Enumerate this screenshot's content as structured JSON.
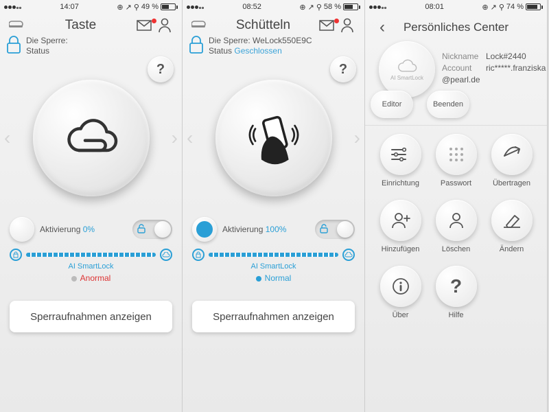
{
  "panels": [
    {
      "status": {
        "time": "14:07",
        "battery_pct": "49 %",
        "battery_fill": 0.49
      },
      "title": "Taste",
      "lock": {
        "name_key": "Die Sperre:",
        "name_val": "",
        "status_key": "Status",
        "status_val": ""
      },
      "dial_icon": "cloud",
      "activation": {
        "label": "Aktivierung",
        "pct": "0%",
        "on": false
      },
      "bar_label": "AI SmartLock",
      "state": {
        "text": "Anormal",
        "class": "bad"
      },
      "button": "Sperraufnahmen anzeigen"
    },
    {
      "status": {
        "time": "08:52",
        "battery_pct": "58 %",
        "battery_fill": 0.58
      },
      "title": "Schütteln",
      "lock": {
        "name_key": "Die Sperre:",
        "name_val": "WeLock550E9C",
        "status_key": "Status",
        "status_val": "Geschlossen"
      },
      "dial_icon": "shake",
      "activation": {
        "label": "Aktivierung",
        "pct": "100%",
        "on": true
      },
      "bar_label": "AI SmartLock",
      "state": {
        "text": "Normal",
        "class": "ok"
      },
      "button": "Sperraufnahmen anzeigen"
    }
  ],
  "panel3": {
    "status": {
      "time": "08:01",
      "battery_pct": "74 %",
      "battery_fill": 0.74
    },
    "title": "Persönliches Center",
    "avatar_caption": "AI SmartLock",
    "profile": {
      "nickname_key": "Nickname",
      "nickname_val": "Lock#2440",
      "account_key": "Account",
      "account_val": "ric*****.franziska@pearl.de"
    },
    "editor": "Editor",
    "beenden": "Beenden",
    "grid": [
      {
        "icon": "settings",
        "label": "Einrichtung"
      },
      {
        "icon": "password",
        "label": "Passwort"
      },
      {
        "icon": "share",
        "label": "Übertragen"
      },
      {
        "icon": "user-plus",
        "label": "Hinzufügen"
      },
      {
        "icon": "user",
        "label": "Löschen"
      },
      {
        "icon": "eraser",
        "label": "Ändern"
      },
      {
        "icon": "info",
        "label": "Über"
      },
      {
        "icon": "help",
        "label": "Hilfe"
      }
    ]
  },
  "glyphs": {
    "help": "?",
    "mail": "✉",
    "profile": "person",
    "back": "‹"
  }
}
